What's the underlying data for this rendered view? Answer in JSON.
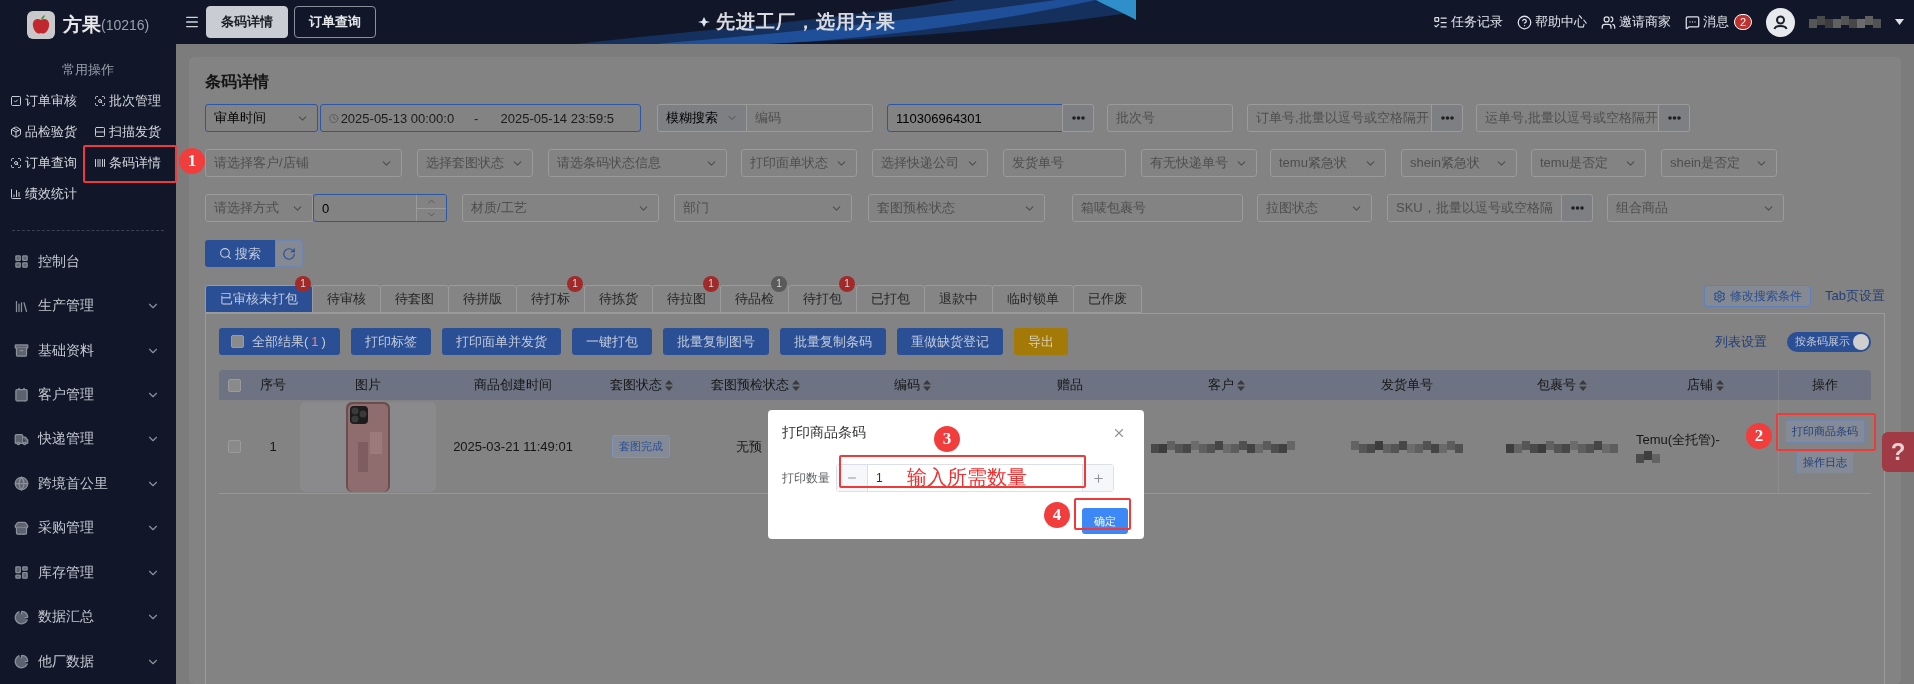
{
  "sidebar": {
    "logo": {
      "name": "方果",
      "account": "(10216)"
    },
    "quick_title": "常用操作",
    "quick_items": [
      {
        "label": "订单审核"
      },
      {
        "label": "批次管理"
      },
      {
        "label": "品检验货"
      },
      {
        "label": "扫描发货"
      },
      {
        "label": "订单查询"
      },
      {
        "label": "条码详情"
      },
      {
        "label": "绩效统计"
      }
    ],
    "nav": [
      {
        "label": "控制台",
        "kind": "link"
      },
      {
        "label": "生产管理",
        "kind": "group"
      },
      {
        "label": "基础资料",
        "kind": "group"
      },
      {
        "label": "客户管理",
        "kind": "group"
      },
      {
        "label": "快递管理",
        "kind": "group"
      },
      {
        "label": "跨境首公里",
        "kind": "group"
      },
      {
        "label": "采购管理",
        "kind": "group"
      },
      {
        "label": "库存管理",
        "kind": "group"
      },
      {
        "label": "数据汇总",
        "kind": "group"
      },
      {
        "label": "他厂数据",
        "kind": "group"
      }
    ]
  },
  "topbar": {
    "tabs": [
      {
        "label": "条码详情",
        "selected": true
      },
      {
        "label": "订单查询",
        "selected": false
      }
    ],
    "slogan": "先进工厂，选用方果",
    "links": [
      {
        "label": "任务记录"
      },
      {
        "label": "帮助中心"
      },
      {
        "label": "邀请商家"
      },
      {
        "label": "消息",
        "badge": "2"
      }
    ],
    "user": {
      "kind": "redacted"
    }
  },
  "page": {
    "title": "条码详情",
    "filter_rows": [
      [
        {
          "kind": "select",
          "value": "审单时间",
          "active": true
        },
        {
          "kind": "date-range",
          "start": "2025-05-13 00:00:0",
          "separator": "-",
          "end": "2025-05-14 23:59:5",
          "active": true
        },
        {
          "kind": "combo",
          "mode": "模糊搜索",
          "placeholder": "编码",
          "active": false
        },
        {
          "kind": "input-more",
          "value": "110306964301",
          "active": true
        },
        {
          "kind": "input",
          "placeholder": "批次号",
          "active": false
        },
        {
          "kind": "input-more",
          "placeholder": "订单号,批量以逗号或空格隔开",
          "active": false
        },
        {
          "kind": "input-more",
          "placeholder": "运单号,批量以逗号或空格隔开",
          "active": false
        }
      ],
      [
        {
          "kind": "select",
          "placeholder": "请选择客户/店铺",
          "active": false
        },
        {
          "kind": "select",
          "placeholder": "选择套图状态",
          "active": false
        },
        {
          "kind": "select",
          "placeholder": "请选条码状态信息",
          "active": false
        },
        {
          "kind": "select",
          "placeholder": "打印面单状态",
          "active": false
        },
        {
          "kind": "select",
          "placeholder": "选择快递公司",
          "active": false
        },
        {
          "kind": "input",
          "placeholder": "发货单号",
          "active": false
        },
        {
          "kind": "select",
          "placeholder": "有无快递单号",
          "active": false
        },
        {
          "kind": "select",
          "placeholder": "temu紧急状",
          "active": false
        },
        {
          "kind": "select",
          "placeholder": "shein紧急状",
          "active": false
        },
        {
          "kind": "select",
          "placeholder": "temu是否定",
          "active": false
        },
        {
          "kind": "select",
          "placeholder": "shein是否定",
          "active": false
        }
      ],
      [
        {
          "kind": "select",
          "placeholder": "请选择方式",
          "active": false
        },
        {
          "kind": "number",
          "value": "0",
          "active": true
        },
        {
          "kind": "select",
          "placeholder": "材质/工艺",
          "active": false
        },
        {
          "kind": "select",
          "placeholder": "部门",
          "active": false
        },
        {
          "kind": "select",
          "placeholder": "套图预检状态",
          "active": false
        },
        {
          "kind": "input",
          "placeholder": "箱唛包裹号",
          "active": false
        },
        {
          "kind": "select",
          "placeholder": "拉图状态",
          "active": false
        },
        {
          "kind": "input-more",
          "placeholder": "SKU，批量以逗号或空格隔",
          "active": false
        },
        {
          "kind": "select",
          "placeholder": "组合商品",
          "active": false
        }
      ]
    ],
    "search_button": "搜索",
    "tabs": [
      {
        "label": "已审核未打包",
        "selected": true,
        "badge": "1",
        "color": "#a02a2a"
      },
      {
        "label": "待审核",
        "selected": false
      },
      {
        "label": "待套图",
        "selected": false
      },
      {
        "label": "待拼版",
        "selected": false
      },
      {
        "label": "待打标",
        "selected": false,
        "badge": "1",
        "color": "#a02a2a"
      },
      {
        "label": "待拣货",
        "selected": false
      },
      {
        "label": "待拉图",
        "selected": false,
        "badge": "1",
        "color": "#a02a2a"
      },
      {
        "label": "待品检",
        "selected": false,
        "badge": "1",
        "color": "#5a5a5a"
      },
      {
        "label": "待打包",
        "selected": false,
        "badge": "1",
        "color": "#a02a2a"
      },
      {
        "label": "已打包",
        "selected": false
      },
      {
        "label": "退款中",
        "selected": false
      },
      {
        "label": "临时锁单",
        "selected": false
      },
      {
        "label": "已作废",
        "selected": false
      }
    ],
    "modify_search": "修改搜索条件",
    "tab_settings": "Tab页设置",
    "actions": [
      {
        "kind": "select-all",
        "prefix": "全部结果(",
        "count": "1",
        "suffix": ")",
        "checked": false
      },
      {
        "kind": "primary",
        "label": "打印标签"
      },
      {
        "kind": "primary",
        "label": "打印面单并发货"
      },
      {
        "kind": "primary",
        "label": "一键打包"
      },
      {
        "kind": "primary",
        "label": "批量复制图号"
      },
      {
        "kind": "primary",
        "label": "批量复制条码"
      },
      {
        "kind": "primary",
        "label": "重做缺货登记"
      },
      {
        "kind": "warning",
        "label": "导出"
      }
    ],
    "list_settings": "列表设置",
    "view_toggle": {
      "label": "按条码展示",
      "on": true
    },
    "table": {
      "columns": [
        {
          "kind": "checkbox",
          "checked": false
        },
        {
          "kind": "text",
          "label": "序号",
          "sortable": false
        },
        {
          "kind": "text",
          "label": "图片",
          "sortable": false
        },
        {
          "kind": "text",
          "label": "商品创建时间",
          "sortable": false
        },
        {
          "kind": "text",
          "label": "套图状态",
          "sortable": true
        },
        {
          "kind": "text",
          "label": "套图预检状态",
          "sortable": true
        },
        {
          "kind": "text",
          "label": "编码",
          "sortable": true
        },
        {
          "kind": "text",
          "label": "赠品",
          "sortable": false
        },
        {
          "kind": "text",
          "label": "客户",
          "sortable": true
        },
        {
          "kind": "text",
          "label": "发货单号",
          "sortable": false
        },
        {
          "kind": "text",
          "label": "包裹号",
          "sortable": true
        },
        {
          "kind": "text",
          "label": "店铺",
          "sortable": true
        },
        {
          "kind": "text",
          "label": "操作",
          "sortable": false
        }
      ],
      "rows": [
        {
          "checked": false,
          "index": "1",
          "image": {
            "kind": "picture"
          },
          "created": "2025-03-21 11:49:01",
          "status_tag": "套图完成",
          "precheck": "无预",
          "customer": {
            "kind": "redacted"
          },
          "shipment": {
            "kind": "redacted"
          },
          "package": {
            "kind": "redacted"
          },
          "shop": "Temu(全托管)-",
          "shop_rest": {
            "kind": "redacted"
          },
          "actions": [
            "打印商品条码",
            "操作日志"
          ]
        }
      ]
    }
  },
  "dialog": {
    "title": "打印商品条码",
    "label": "打印数量",
    "value": "1",
    "confirm": "确定"
  },
  "annotations": {
    "markers": [
      "1",
      "2",
      "3",
      "4"
    ],
    "hint": "输入所需数量"
  },
  "help_tab": "?"
}
